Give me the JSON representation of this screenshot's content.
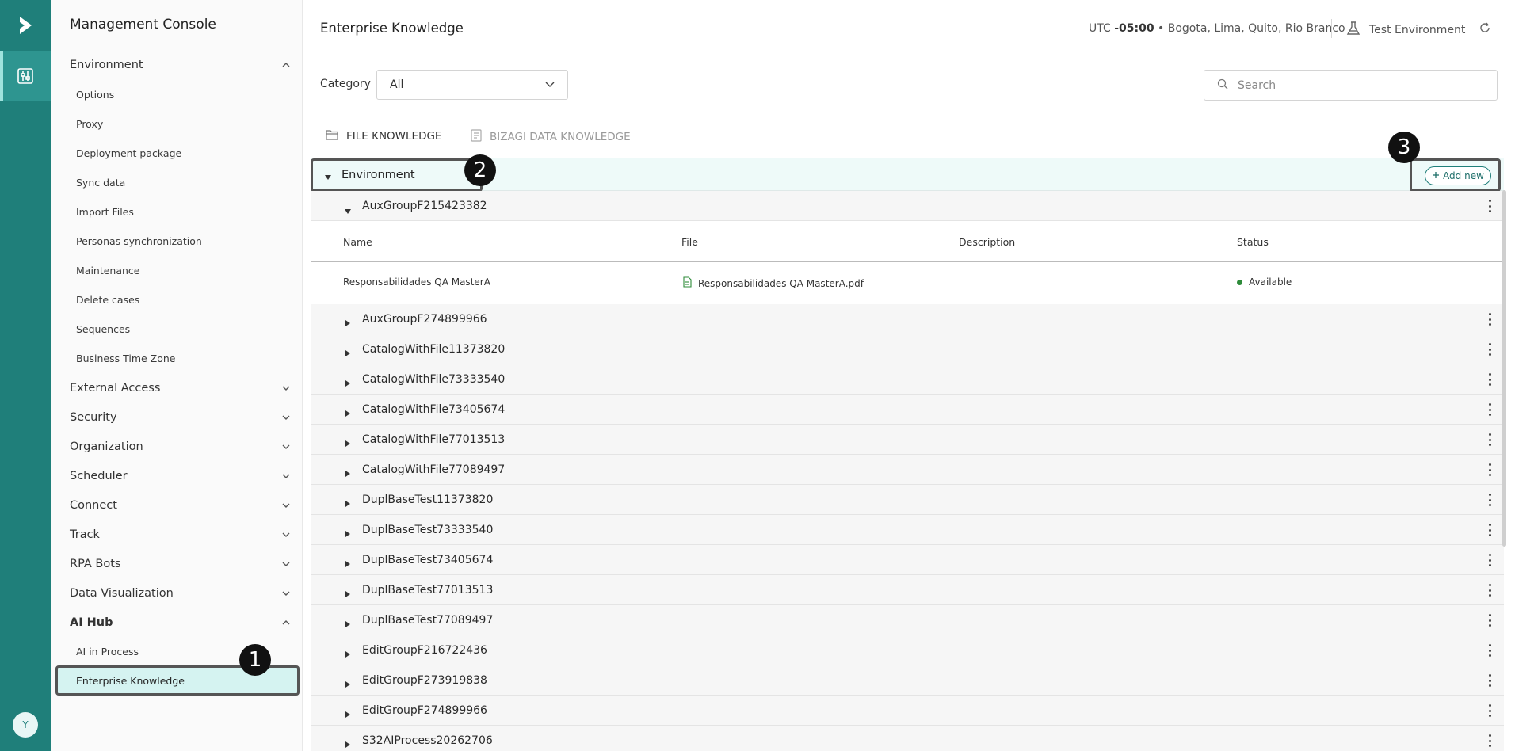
{
  "app": {
    "title": "Management Console",
    "avatar_initial": "Y"
  },
  "sidebar": {
    "environment": {
      "label": "Environment",
      "expanded": true,
      "items": [
        "Options",
        "Proxy",
        "Deployment package",
        "Sync data",
        "Import Files",
        "Personas synchronization",
        "Maintenance",
        "Delete cases",
        "Sequences",
        "Business Time Zone"
      ]
    },
    "groups": [
      "External Access",
      "Security",
      "Organization",
      "Scheduler",
      "Connect",
      "Track",
      "RPA Bots",
      "Data Visualization"
    ],
    "ai_hub": {
      "label": "AI Hub",
      "expanded": true,
      "items": [
        "AI in Process",
        "Enterprise Knowledge"
      ],
      "selected": "Enterprise Knowledge"
    }
  },
  "header": {
    "title": "Enterprise Knowledge",
    "timezone_prefix": "UTC ",
    "timezone_offset": "-05:00",
    "timezone_cities": " • Bogota, Lima, Quito, Rio Branco",
    "environment": "Test Environment"
  },
  "filters": {
    "category_label": "Category",
    "category_value": "All",
    "search_placeholder": "Search"
  },
  "tabs": [
    {
      "label": "FILE KNOWLEDGE",
      "active": true
    },
    {
      "label": "BIZAGI DATA KNOWLEDGE",
      "active": false
    }
  ],
  "tree": {
    "root": "Environment",
    "add_new_label": "Add new",
    "expanded_group": "AuxGroupF215423382",
    "columns": [
      "Name",
      "File",
      "Description",
      "Status"
    ],
    "rows": [
      {
        "name": "Responsabilidades QA MasterA",
        "file": "Responsabilidades QA MasterA.pdf",
        "description": "",
        "status": "Available"
      }
    ],
    "groups": [
      "AuxGroupF274899966",
      "CatalogWithFile11373820",
      "CatalogWithFile73333540",
      "CatalogWithFile73405674",
      "CatalogWithFile77013513",
      "CatalogWithFile77089497",
      "DuplBaseTest11373820",
      "DuplBaseTest73333540",
      "DuplBaseTest73405674",
      "DuplBaseTest77013513",
      "DuplBaseTest77089497",
      "EditGroupF216722436",
      "EditGroupF273919838",
      "EditGroupF274899966",
      "S32AIProcess20262706"
    ]
  },
  "callouts": [
    "1",
    "2",
    "3"
  ],
  "colors": {
    "rail": "#1f7f7a",
    "accent": "#1f7f7a",
    "selected_bg": "#d5f3f1",
    "status_available": "#2e8b3a"
  }
}
